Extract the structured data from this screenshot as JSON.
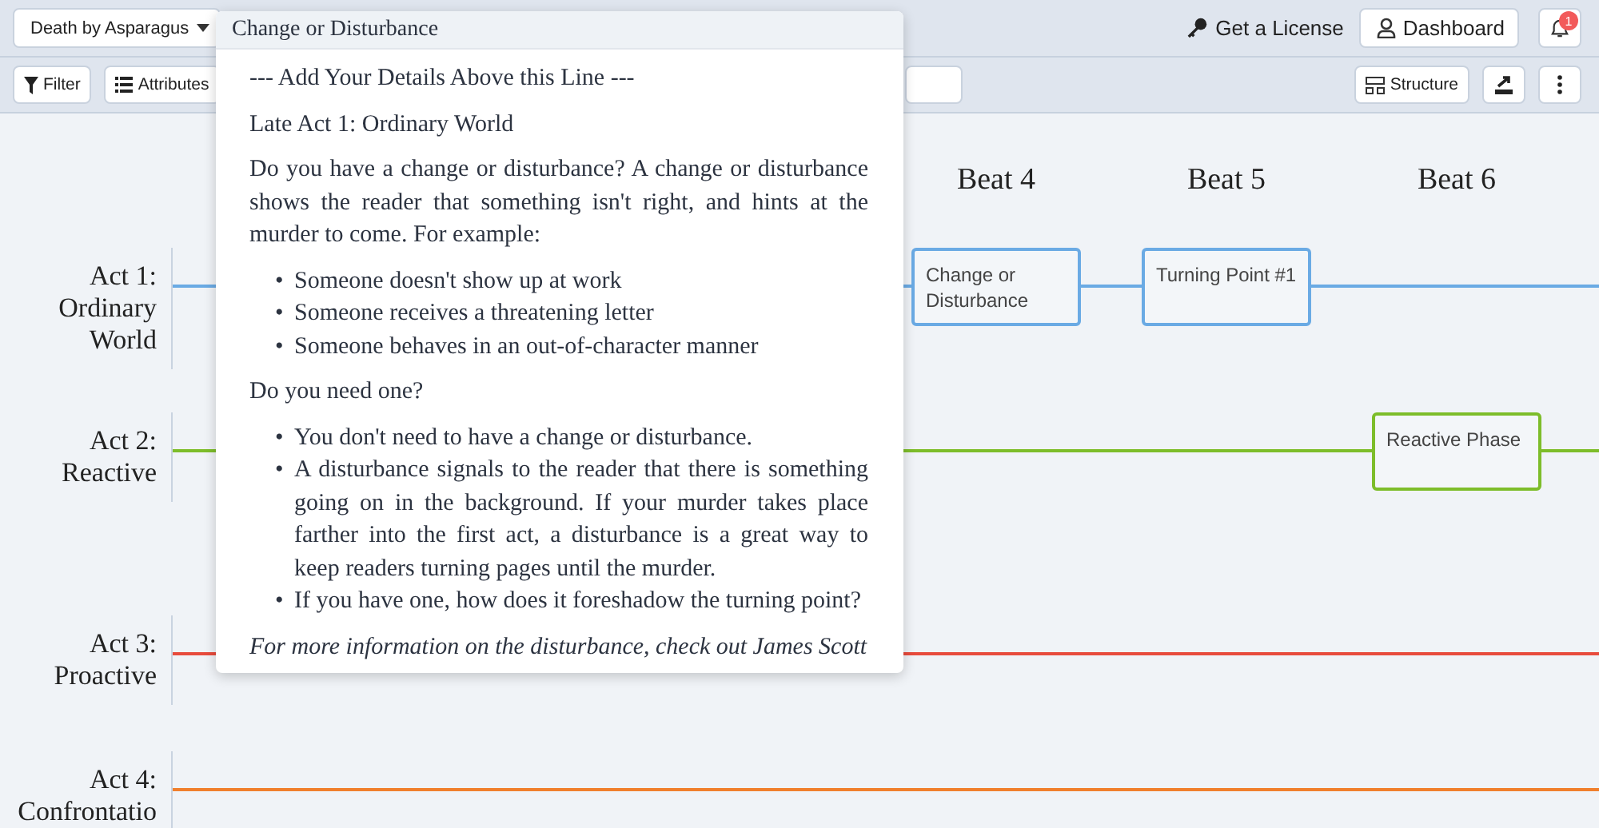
{
  "topbar": {
    "project": "Death by Asparagus",
    "license_link": "Get a License",
    "dashboard_button": "Dashboard",
    "notifications_badge": "1"
  },
  "toolbar": {
    "filter_button": "Filter",
    "attributes_button": "Attributes",
    "structure_button": "Structure"
  },
  "beats": [
    "Beat 4",
    "Beat 5",
    "Beat 6"
  ],
  "acts": [
    {
      "label": "Act 1: Ordinary World",
      "color": "#6aaae4",
      "slots": [
        {
          "kind": "card",
          "text": "Change or Disturbance"
        },
        {
          "kind": "card",
          "text": "Turning Point #1"
        },
        {
          "kind": "empty"
        }
      ]
    },
    {
      "label": "Act 2: Reactive",
      "color": "#7dbd2a",
      "slots": [
        {
          "kind": "empty"
        },
        {
          "kind": "empty"
        },
        {
          "kind": "card",
          "text": "Reactive Phase"
        }
      ]
    },
    {
      "label": "Act 3: Proactive",
      "color": "#e84b3c"
    },
    {
      "label": "Act 4: Confrontatio",
      "color": "#f07f2d"
    }
  ],
  "popover": {
    "title": "Change or Disturbance",
    "blocks": [
      {
        "kind": "para",
        "text": "--- Add Your Details Above this Line ---"
      },
      {
        "kind": "para",
        "text": "Late Act 1: Ordinary World"
      },
      {
        "kind": "para",
        "text": "Do you have a change or disturbance? A change or disturbance shows the reader that something isn't right, and hints at the murder to come. For example:"
      },
      {
        "kind": "list",
        "marker": "•",
        "items": [
          "Someone doesn't show up at work",
          "Someone receives a threatening letter",
          "Someone behaves in an out-of-character manner"
        ]
      },
      {
        "kind": "para",
        "text": "Do you need one?"
      },
      {
        "kind": "list",
        "marker": "•",
        "items": [
          "You don't need to have a change or disturbance.",
          "A disturbance signals to the reader that there is something going on in the background. If your murder takes place farther into the first act, a disturbance is a great way to keep readers turning pages until the murder.",
          "If you have one, how does it foreshadow the turning point?"
        ]
      },
      {
        "kind": "note",
        "text": "For more information on the disturbance, check out James Scott"
      }
    ]
  }
}
